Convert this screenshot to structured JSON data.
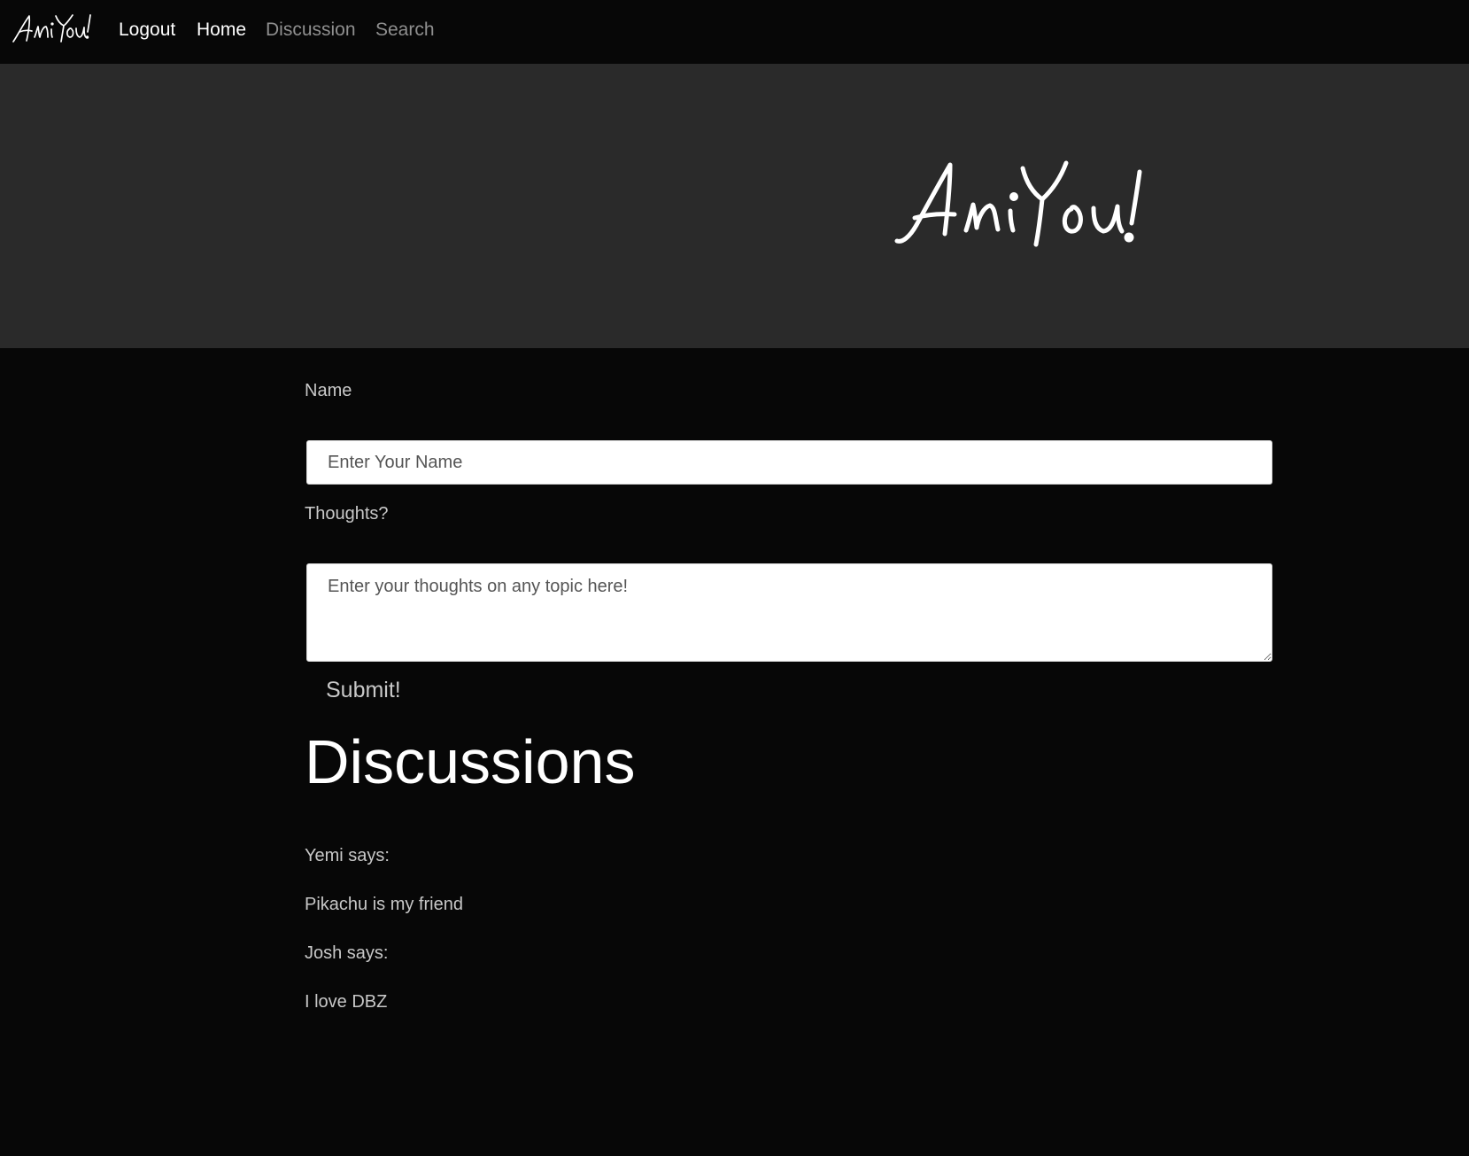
{
  "navbar": {
    "brand": "AniYou!",
    "links": [
      {
        "label": "Logout"
      },
      {
        "label": "Home"
      },
      {
        "label": "Discussion"
      },
      {
        "label": "Search"
      }
    ]
  },
  "hero": {
    "logo_text": "AniYou!"
  },
  "form": {
    "name_label": "Name",
    "name_placeholder": "Enter Your Name",
    "name_value": "",
    "thoughts_label": "Thoughts?",
    "thoughts_placeholder": "Enter your thoughts on any topic here!",
    "thoughts_value": "",
    "submit_label": "Submit!"
  },
  "discussions": {
    "heading": "Discussions",
    "posts": [
      {
        "author_line": "Yemi says:",
        "text": "Pikachu is my friend"
      },
      {
        "author_line": "Josh says:",
        "text": "I love DBZ"
      }
    ]
  },
  "colors": {
    "page_background": "#070707",
    "hero_background": "#2a2a2a",
    "text_primary": "#ffffff",
    "text_secondary": "#c8c8c8",
    "nav_muted": "#8f8f8f"
  }
}
